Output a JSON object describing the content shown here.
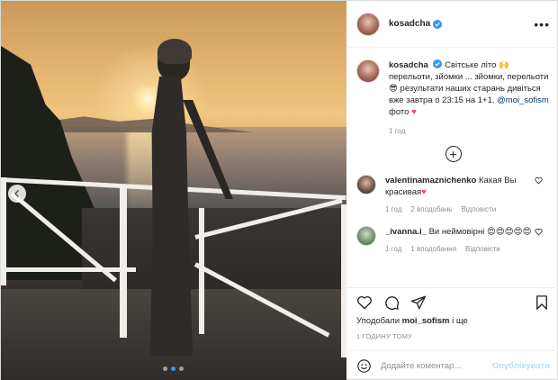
{
  "post": {
    "author": "kosadcha",
    "verified": true,
    "caption_text_1": "Світське літо",
    "caption_text_2": "перельоти, зйомки ... зйомки, перельоти",
    "caption_text_3": "результати наших старань дивіться вже завтра о 23:15 на 1+1.",
    "caption_mention": "@moi_sofism",
    "caption_text_4": "фото",
    "caption_time": "1 год",
    "carousel": {
      "slide_count": 3,
      "active_slide": 1
    }
  },
  "comments": [
    {
      "user": "valentinamaznichenko",
      "text": "Какая Вы красивая",
      "time": "1 год",
      "likes": "2 вподобань",
      "reply": "Відповісти"
    },
    {
      "user": "_ivanna.i_",
      "text": "Ви неймовірні",
      "time": "1 год",
      "likes": "1 вподобання",
      "reply": "Відповісти"
    }
  ],
  "likes_line": {
    "prefix": "Уподобали",
    "user": "moi_sofism",
    "suffix": "і ще"
  },
  "timestamp": "1 ГОДИНУ ТОМУ",
  "add_comment": {
    "placeholder": "Додайте коментар...",
    "publish_label": "Опублікувати"
  },
  "icons": {
    "more": "more-dots-icon",
    "load_more": "plus-circle-icon",
    "like": "heart-icon",
    "comment": "comment-icon",
    "share": "paper-plane-icon",
    "save": "bookmark-icon",
    "emoji": "smiley-icon"
  },
  "colors": {
    "verified": "#3897f0",
    "link": "#00376b",
    "heart": "#ed4956",
    "secondary": "#8e8e8e",
    "publish_disabled": "#b2dffc"
  }
}
